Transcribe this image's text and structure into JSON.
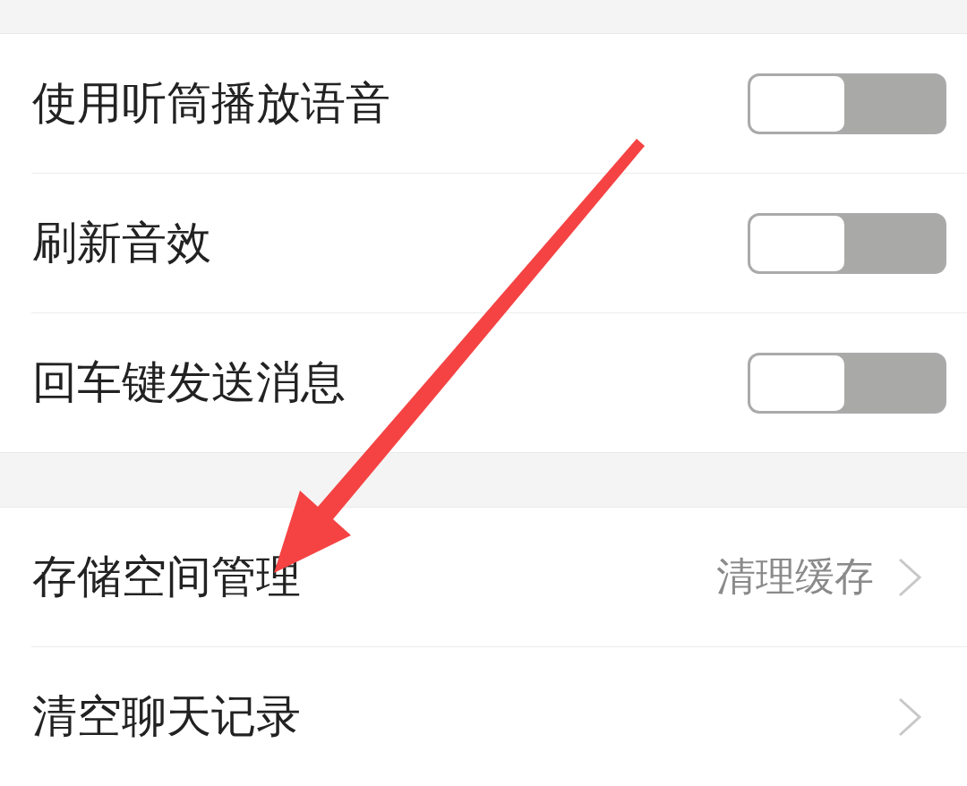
{
  "sections": [
    {
      "rows": [
        {
          "kind": "toggle",
          "label": "使用听筒播放语音",
          "on": false
        },
        {
          "kind": "toggle",
          "label": "刷新音效",
          "on": false
        },
        {
          "kind": "toggle",
          "label": "回车键发送消息",
          "on": false
        }
      ]
    },
    {
      "rows": [
        {
          "kind": "link",
          "label": "存储空间管理",
          "value": "清理缓存"
        },
        {
          "kind": "link",
          "label": "清空聊天记录"
        }
      ]
    }
  ],
  "annotations": [
    {
      "kind": "arrow"
    }
  ]
}
